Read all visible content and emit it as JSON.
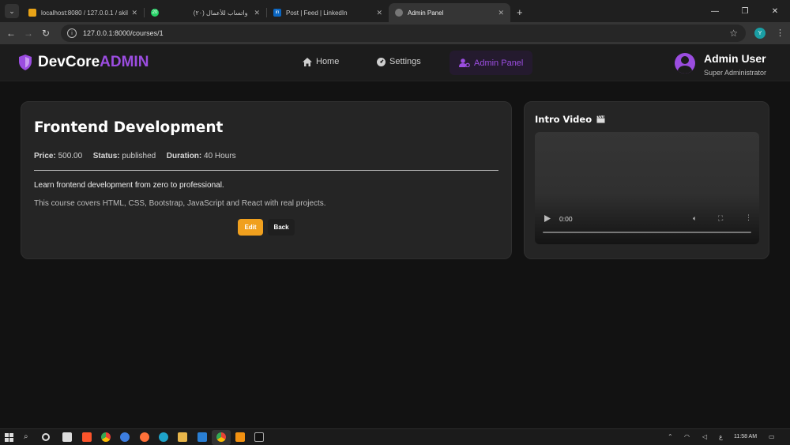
{
  "browser": {
    "tabs": [
      {
        "title": "localhost:8080 / 127.0.0.1 / skill",
        "favicon_color": "#e8a317",
        "active": false
      },
      {
        "title": "واتساب للأعمال (٢٠)",
        "favicon_color": "#25d366",
        "badge": "20",
        "active": false
      },
      {
        "title": "Post | Feed | LinkedIn",
        "favicon_color": "#0a66c2",
        "badge": "in",
        "active": false
      },
      {
        "title": "Admin Panel",
        "favicon_color": "#888888",
        "active": true
      }
    ],
    "url": "127.0.0.1:8000/courses/1",
    "profile_initial": "Y"
  },
  "nav": {
    "brand_main": "DevCore",
    "brand_accent": "ADMIN",
    "links": [
      {
        "label": "Home",
        "icon": "home-icon"
      },
      {
        "label": "Settings",
        "icon": "gauge-icon"
      },
      {
        "label": "Admin Panel",
        "icon": "user-gear-icon",
        "active": true
      }
    ],
    "user_name": "Admin User",
    "user_role": "Super Administrator",
    "accent_color": "#9b4de0"
  },
  "course": {
    "title": "Frontend Development",
    "price_label": "Price:",
    "price": "500.00",
    "status_label": "Status:",
    "status": "published",
    "duration_label": "Duration:",
    "duration": "40 Hours",
    "lead": "Learn frontend development from zero to professional.",
    "description": "This course covers HTML, CSS, Bootstrap, JavaScript and React with real projects.",
    "edit_label": "Edit",
    "back_label": "Back"
  },
  "video": {
    "heading": "Intro Video",
    "time": "0:00"
  },
  "taskbar": {
    "clock": "11:58 AM",
    "lang": "ع"
  }
}
